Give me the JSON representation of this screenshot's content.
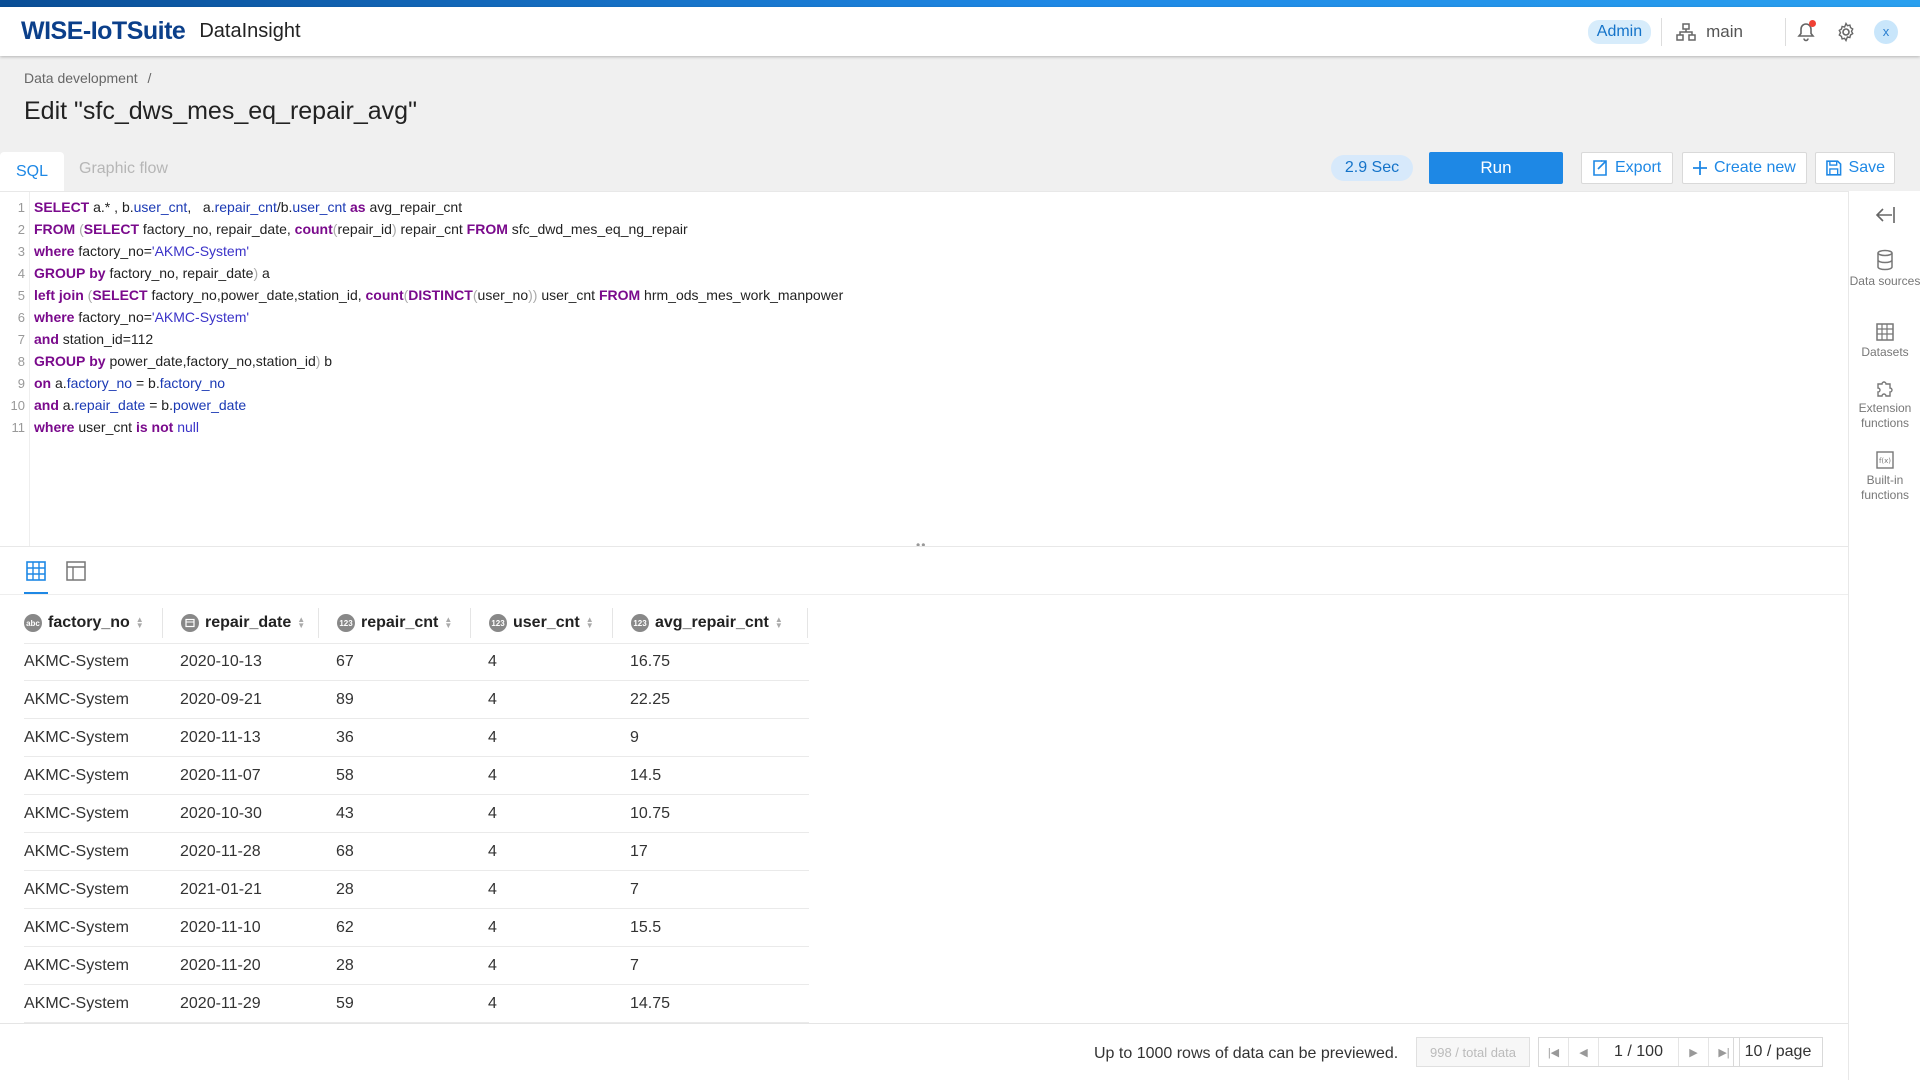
{
  "header": {
    "logo": "WISE-IoTSuite",
    "app_name": "DataInsight",
    "role_badge": "Admin",
    "branch": "main",
    "avatar_letter": "x"
  },
  "breadcrumb": {
    "item": "Data development",
    "separator": "/"
  },
  "page_title": "Edit \"sfc_dws_mes_eq_repair_avg\"",
  "tabs": [
    {
      "label": "SQL",
      "active": true
    },
    {
      "label": "Graphic flow",
      "active": false
    }
  ],
  "toolbar": {
    "exec_time": "2.9 Sec",
    "run_label": "Run",
    "export_label": "Export",
    "create_label": "Create new",
    "save_label": "Save"
  },
  "editor": {
    "line_numbers": [
      "1",
      "2",
      "3",
      "4",
      "5",
      "6",
      "7",
      "8",
      "9",
      "10",
      "11"
    ],
    "sql": [
      "SELECT a.* , b.user_cnt,   a.repair_cnt/b.user_cnt as avg_repair_cnt",
      "FROM (SELECT factory_no, repair_date, count(repair_id) repair_cnt FROM sfc_dwd_mes_eq_ng_repair",
      "where factory_no='AKMC-System'",
      "GROUP by factory_no, repair_date) a",
      "left join (SELECT factory_no,power_date,station_id, count(DISTINCT(user_no)) user_cnt FROM hrm_ods_mes_work_manpower",
      "where factory_no='AKMC-System'",
      "and station_id=112",
      "GROUP by power_date,factory_no,station_id) b",
      "on a.factory_no = b.factory_no",
      "and a.repair_date = b.power_date",
      "where user_cnt is not null"
    ]
  },
  "right_panel": [
    {
      "label": "Data sources",
      "icon": "database-icon"
    },
    {
      "label": "Datasets",
      "icon": "table-icon"
    },
    {
      "label": "Extension functions",
      "icon": "puzzle-icon"
    },
    {
      "label": "Built-in functions",
      "icon": "function-icon"
    }
  ],
  "table": {
    "columns": [
      {
        "name": "factory_no",
        "type": "abc"
      },
      {
        "name": "repair_date",
        "type": "date"
      },
      {
        "name": "repair_cnt",
        "type": "123"
      },
      {
        "name": "user_cnt",
        "type": "123"
      },
      {
        "name": "avg_repair_cnt",
        "type": "123"
      }
    ],
    "rows": [
      [
        "AKMC-System",
        "2020-10-13",
        "67",
        "4",
        "16.75"
      ],
      [
        "AKMC-System",
        "2020-09-21",
        "89",
        "4",
        "22.25"
      ],
      [
        "AKMC-System",
        "2020-11-13",
        "36",
        "4",
        "9"
      ],
      [
        "AKMC-System",
        "2020-11-07",
        "58",
        "4",
        "14.5"
      ],
      [
        "AKMC-System",
        "2020-10-30",
        "43",
        "4",
        "10.75"
      ],
      [
        "AKMC-System",
        "2020-11-28",
        "68",
        "4",
        "17"
      ],
      [
        "AKMC-System",
        "2021-01-21",
        "28",
        "4",
        "7"
      ],
      [
        "AKMC-System",
        "2020-11-10",
        "62",
        "4",
        "15.5"
      ],
      [
        "AKMC-System",
        "2020-11-20",
        "28",
        "4",
        "7"
      ],
      [
        "AKMC-System",
        "2020-11-29",
        "59",
        "4",
        "14.75"
      ]
    ]
  },
  "footer": {
    "note": "Up to 1000 rows of data can be previewed.",
    "total": "998 / total data",
    "page": "1 / 100",
    "per_page": "10 / page"
  },
  "colors": {
    "accent": "#1e88e5",
    "logo": "#0b3f8a",
    "keyword": "#7a0a8c",
    "string": "#3a32c8"
  }
}
